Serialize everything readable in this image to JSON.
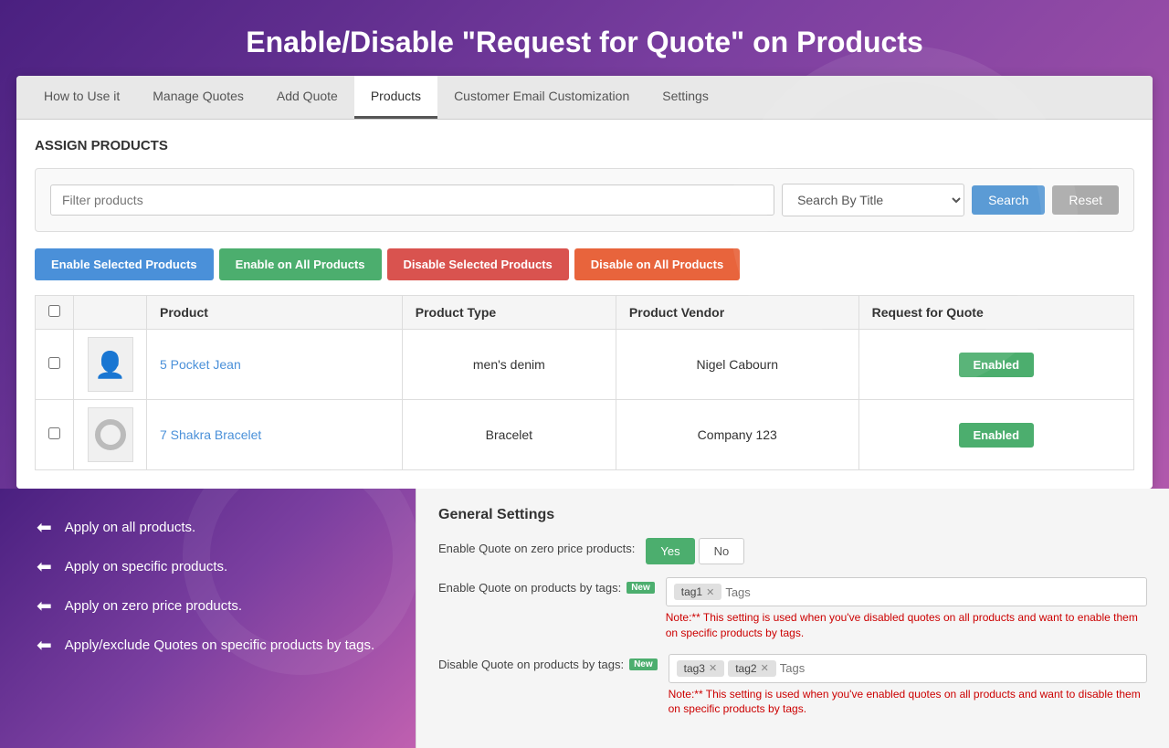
{
  "page": {
    "title": "Enable/Disable \"Request for Quote\" on Products"
  },
  "tabs": [
    {
      "label": "How to Use it",
      "active": false
    },
    {
      "label": "Manage Quotes",
      "active": false
    },
    {
      "label": "Add Quote",
      "active": false
    },
    {
      "label": "Products",
      "active": true
    },
    {
      "label": "Customer Email Customization",
      "active": false
    },
    {
      "label": "Settings",
      "active": false
    }
  ],
  "section": {
    "title": "ASSIGN PRODUCTS"
  },
  "search": {
    "filter_placeholder": "Filter products",
    "search_by_label": "Search By Title",
    "search_btn": "Search",
    "reset_btn": "Reset"
  },
  "action_buttons": {
    "enable_selected": "Enable Selected Products",
    "enable_all": "Enable on All Products",
    "disable_selected": "Disable Selected Products",
    "disable_all": "Disable on All Products"
  },
  "table": {
    "headers": [
      "",
      "",
      "Product",
      "Product Type",
      "Product Vendor",
      "Request for Quote"
    ],
    "rows": [
      {
        "product_name": "5 Pocket Jean",
        "product_type": "men's denim",
        "vendor": "Nigel Cabourn",
        "rfq_status": "Enabled",
        "thumb_type": "person"
      },
      {
        "product_name": "7 Shakra Bracelet",
        "product_type": "Bracelet",
        "vendor": "Company 123",
        "rfq_status": "Enabled",
        "thumb_type": "ring"
      }
    ]
  },
  "features": [
    "Apply on all products.",
    "Apply on specific products.",
    "Apply on zero price products.",
    "Apply/exclude Quotes on specific products by tags."
  ],
  "general_settings": {
    "title": "General Settings",
    "rows": [
      {
        "label": "Enable Quote on zero price products:",
        "type": "yes_no",
        "yes_label": "Yes",
        "no_label": "No",
        "is_new": false
      },
      {
        "label": "Enable Quote on products by tags:",
        "type": "tags",
        "is_new": true,
        "tags": [
          "tag1"
        ],
        "placeholder": "Tags",
        "note": "Note:** This setting is used when you've disabled quotes on all products and want to enable them on specific products by tags."
      },
      {
        "label": "Disable Quote on products by tags:",
        "type": "tags",
        "is_new": true,
        "tags": [
          "tag3",
          "tag2"
        ],
        "placeholder": "Tags",
        "note": "Note:** This setting is used when you've enabled quotes on all products and want to disable them on specific products by tags."
      }
    ]
  }
}
